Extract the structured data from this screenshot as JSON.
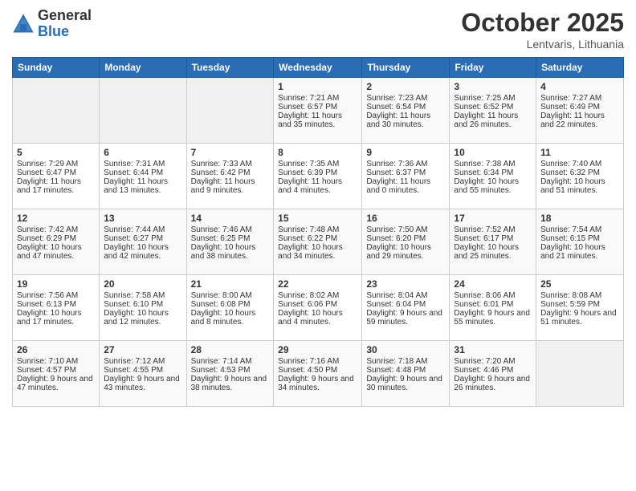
{
  "logo": {
    "general": "General",
    "blue": "Blue"
  },
  "title": "October 2025",
  "location": "Lentvaris, Lithuania",
  "days_header": [
    "Sunday",
    "Monday",
    "Tuesday",
    "Wednesday",
    "Thursday",
    "Friday",
    "Saturday"
  ],
  "weeks": [
    [
      {
        "day": "",
        "empty": true
      },
      {
        "day": "",
        "empty": true
      },
      {
        "day": "",
        "empty": true
      },
      {
        "day": "1",
        "sunrise": "7:21 AM",
        "sunset": "6:57 PM",
        "daylight": "11 hours and 35 minutes."
      },
      {
        "day": "2",
        "sunrise": "7:23 AM",
        "sunset": "6:54 PM",
        "daylight": "11 hours and 30 minutes."
      },
      {
        "day": "3",
        "sunrise": "7:25 AM",
        "sunset": "6:52 PM",
        "daylight": "11 hours and 26 minutes."
      },
      {
        "day": "4",
        "sunrise": "7:27 AM",
        "sunset": "6:49 PM",
        "daylight": "11 hours and 22 minutes."
      }
    ],
    [
      {
        "day": "5",
        "sunrise": "7:29 AM",
        "sunset": "6:47 PM",
        "daylight": "11 hours and 17 minutes."
      },
      {
        "day": "6",
        "sunrise": "7:31 AM",
        "sunset": "6:44 PM",
        "daylight": "11 hours and 13 minutes."
      },
      {
        "day": "7",
        "sunrise": "7:33 AM",
        "sunset": "6:42 PM",
        "daylight": "11 hours and 9 minutes."
      },
      {
        "day": "8",
        "sunrise": "7:35 AM",
        "sunset": "6:39 PM",
        "daylight": "11 hours and 4 minutes."
      },
      {
        "day": "9",
        "sunrise": "7:36 AM",
        "sunset": "6:37 PM",
        "daylight": "11 hours and 0 minutes."
      },
      {
        "day": "10",
        "sunrise": "7:38 AM",
        "sunset": "6:34 PM",
        "daylight": "10 hours and 55 minutes."
      },
      {
        "day": "11",
        "sunrise": "7:40 AM",
        "sunset": "6:32 PM",
        "daylight": "10 hours and 51 minutes."
      }
    ],
    [
      {
        "day": "12",
        "sunrise": "7:42 AM",
        "sunset": "6:29 PM",
        "daylight": "10 hours and 47 minutes."
      },
      {
        "day": "13",
        "sunrise": "7:44 AM",
        "sunset": "6:27 PM",
        "daylight": "10 hours and 42 minutes."
      },
      {
        "day": "14",
        "sunrise": "7:46 AM",
        "sunset": "6:25 PM",
        "daylight": "10 hours and 38 minutes."
      },
      {
        "day": "15",
        "sunrise": "7:48 AM",
        "sunset": "6:22 PM",
        "daylight": "10 hours and 34 minutes."
      },
      {
        "day": "16",
        "sunrise": "7:50 AM",
        "sunset": "6:20 PM",
        "daylight": "10 hours and 29 minutes."
      },
      {
        "day": "17",
        "sunrise": "7:52 AM",
        "sunset": "6:17 PM",
        "daylight": "10 hours and 25 minutes."
      },
      {
        "day": "18",
        "sunrise": "7:54 AM",
        "sunset": "6:15 PM",
        "daylight": "10 hours and 21 minutes."
      }
    ],
    [
      {
        "day": "19",
        "sunrise": "7:56 AM",
        "sunset": "6:13 PM",
        "daylight": "10 hours and 17 minutes."
      },
      {
        "day": "20",
        "sunrise": "7:58 AM",
        "sunset": "6:10 PM",
        "daylight": "10 hours and 12 minutes."
      },
      {
        "day": "21",
        "sunrise": "8:00 AM",
        "sunset": "6:08 PM",
        "daylight": "10 hours and 8 minutes."
      },
      {
        "day": "22",
        "sunrise": "8:02 AM",
        "sunset": "6:06 PM",
        "daylight": "10 hours and 4 minutes."
      },
      {
        "day": "23",
        "sunrise": "8:04 AM",
        "sunset": "6:04 PM",
        "daylight": "9 hours and 59 minutes."
      },
      {
        "day": "24",
        "sunrise": "8:06 AM",
        "sunset": "6:01 PM",
        "daylight": "9 hours and 55 minutes."
      },
      {
        "day": "25",
        "sunrise": "8:08 AM",
        "sunset": "5:59 PM",
        "daylight": "9 hours and 51 minutes."
      }
    ],
    [
      {
        "day": "26",
        "sunrise": "7:10 AM",
        "sunset": "4:57 PM",
        "daylight": "9 hours and 47 minutes."
      },
      {
        "day": "27",
        "sunrise": "7:12 AM",
        "sunset": "4:55 PM",
        "daylight": "9 hours and 43 minutes."
      },
      {
        "day": "28",
        "sunrise": "7:14 AM",
        "sunset": "4:53 PM",
        "daylight": "9 hours and 38 minutes."
      },
      {
        "day": "29",
        "sunrise": "7:16 AM",
        "sunset": "4:50 PM",
        "daylight": "9 hours and 34 minutes."
      },
      {
        "day": "30",
        "sunrise": "7:18 AM",
        "sunset": "4:48 PM",
        "daylight": "9 hours and 30 minutes."
      },
      {
        "day": "31",
        "sunrise": "7:20 AM",
        "sunset": "4:46 PM",
        "daylight": "9 hours and 26 minutes."
      },
      {
        "day": "",
        "empty": true
      }
    ]
  ]
}
